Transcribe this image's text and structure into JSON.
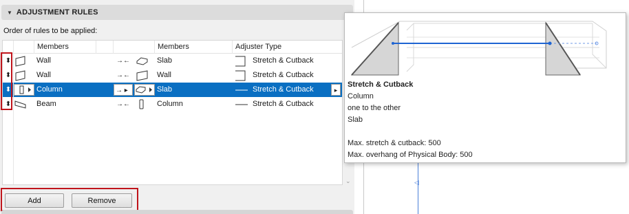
{
  "section": {
    "title": "ADJUSTMENT RULES"
  },
  "order_label": "Order of rules to be applied:",
  "columns": {
    "members1": "Members",
    "members2": "Members",
    "adjuster_type": "Adjuster Type"
  },
  "rows": [
    {
      "member": "Wall",
      "target": "Slab",
      "adjuster": "Stretch & Cutback",
      "member_icon": "wall-icon",
      "target_icon": "slab-icon",
      "adjuster_icon": "bracket-icon"
    },
    {
      "member": "Wall",
      "target": "Wall",
      "adjuster": "Stretch & Cutback",
      "member_icon": "wall-icon",
      "target_icon": "wall-icon",
      "adjuster_icon": "bracket-icon"
    },
    {
      "member": "Column",
      "target": "Slab",
      "adjuster": "Stretch & Cutback",
      "member_icon": "column-icon",
      "target_icon": "slab-icon",
      "adjuster_icon": "line-icon",
      "selected": true
    },
    {
      "member": "Beam",
      "target": "Column",
      "adjuster": "Stretch & Cutback",
      "member_icon": "beam-icon",
      "target_icon": "column-icon",
      "adjuster_icon": "line-icon"
    }
  ],
  "buttons": {
    "add": "Add",
    "remove": "Remove"
  },
  "popup": {
    "title": "Stretch & Cutback",
    "line1": "Column",
    "line2": "one to the other",
    "line3": "Slab",
    "line4": "Max. stretch & cutback: 500",
    "line5": "Max. overhang of Physical Body: 500"
  },
  "colors": {
    "selection": "#0a6fc2",
    "highlight_frame": "#c0141b",
    "accent_line": "#1e64d2"
  }
}
